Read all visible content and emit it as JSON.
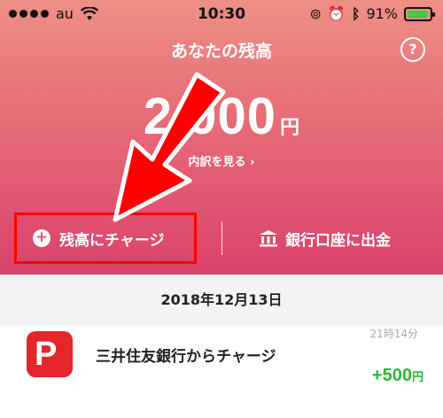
{
  "status_bar": {
    "carrier": "au",
    "time": "10:30",
    "battery_percent": "91%",
    "battery_level": 0.91
  },
  "balance": {
    "title": "あなたの残高",
    "help_label": "?",
    "amount": "2,000",
    "amount_visible": "000",
    "unit": "円",
    "breakdown_link": "内訳を見る ›"
  },
  "actions": {
    "charge_label": "残高にチャージ",
    "withdraw_label": "銀行口座に出金"
  },
  "history": {
    "date": "2018年12月13日",
    "items": [
      {
        "time": "21時14分",
        "title": "三井住友銀行からチャージ",
        "amount": "+500",
        "unit": "円"
      }
    ]
  },
  "colors": {
    "header_top": "#ee8f86",
    "header_bottom": "#d9426a",
    "highlight": "#ff0000",
    "positive": "#2db73b",
    "paypay_red": "#e4262b"
  }
}
